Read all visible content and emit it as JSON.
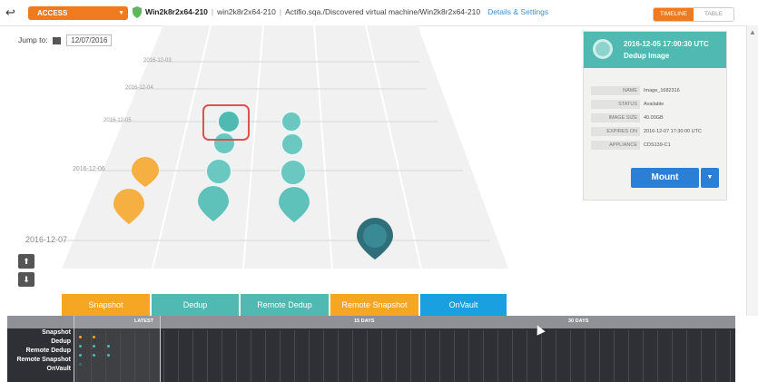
{
  "topbar": {
    "access_label": "ACCESS",
    "host": "Win2k8r2x64-210",
    "host_lower": "win2k8r2x64-210",
    "path": "Actifio.sqa./Discovered virtual machine/Win2k8r2x64-210",
    "details_link": "Details & Settings",
    "view_timeline": "TIMELINE",
    "view_table": "TABLE"
  },
  "jump": {
    "label": "Jump to:",
    "date": "12/07/2016"
  },
  "rows": [
    {
      "label": "2016-12-03"
    },
    {
      "label": "2016-12-04"
    },
    {
      "label": "2016-12-05"
    },
    {
      "label": "2016-12-06"
    },
    {
      "label": "2016-12-07"
    }
  ],
  "lanes": [
    {
      "label": "Snapshot",
      "color": "#f5a623"
    },
    {
      "label": "Dedup",
      "color": "#4fb9b2"
    },
    {
      "label": "Remote Dedup",
      "color": "#4fb9b2"
    },
    {
      "label": "Remote Snapshot",
      "color": "#f5a623"
    },
    {
      "label": "OnVault",
      "color": "#1a9fe0"
    }
  ],
  "panel": {
    "timestamp": "2016-12-05 17:00:30 UTC",
    "kind": "Dedup Image",
    "fields": [
      {
        "key": "NAME",
        "value": "Image_1682316"
      },
      {
        "key": "STATUS",
        "value": "Available"
      },
      {
        "key": "IMAGE SIZE",
        "value": "40.00GB"
      },
      {
        "key": "EXPIRES ON",
        "value": "2016-12-07 17:30:00 UTC"
      },
      {
        "key": "APPLIANCE",
        "value": "CDS139-C1"
      }
    ],
    "mount_label": "Mount"
  },
  "strip": {
    "latest": "LATEST",
    "days15": "15 DAYS",
    "days30": "30 DAYS",
    "series": [
      "Snapshot",
      "Dedup",
      "Remote Dedup",
      "Remote Snapshot",
      "OnVault"
    ]
  },
  "colors": {
    "accent": "#f07a1e",
    "teal": "#4fb9b2",
    "orange": "#f5a623",
    "blue": "#1a9fe0",
    "dark_teal": "#2f6f7a"
  }
}
